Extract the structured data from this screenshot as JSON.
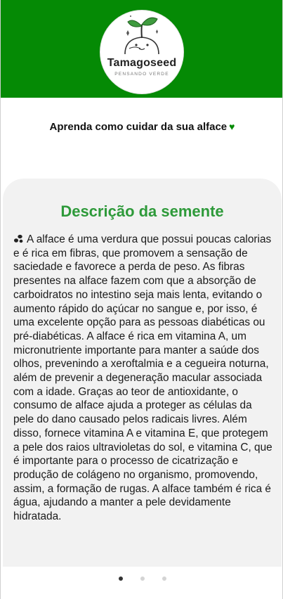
{
  "header": {
    "brand_name": "Tamagoseed",
    "slogan": "PENSANDO VERDE",
    "background_color": "#058a05"
  },
  "subtitle": {
    "text": "Aprenda como cuidar da sua alface",
    "icon": "heart-icon"
  },
  "card": {
    "title": "Descrição da semente",
    "title_color": "#2e9a3a",
    "lead_icon": "seeds-icon",
    "description": "A alface é uma verdura que possui poucas calorias e é rica em fibras, que promovem a sensação de saciedade e favorece a perda de peso. As fibras presentes na alface fazem com que a absorção de carboidratos no intestino seja mais lenta, evitando o aumento rápido do açúcar no sangue e, por isso, é uma excelente opção para as pessoas diabéticas ou pré-diabéticas. A alface é rica em vitamina A, um micronutriente importante para manter a saúde dos olhos, prevenindo a xeroftalmia e a cegueira noturna, além de prevenir a degeneração macular associada com a idade. Graças ao teor de antioxidante, o consumo de alface ajuda a proteger as células da pele do dano causado pelos radicais livres. Além disso, fornece vitamina A e vitamina E, que protegem a pele dos raios ultravioletas do sol, e vitamina C, que é importante para o processo de cicatrização e produção de colágeno no organismo, promovendo, assim, a formação de rugas. A alface também é rica é água, ajudando a manter a pele devidamente hidratada."
  },
  "pagination": {
    "total": 3,
    "active_index": 0
  }
}
